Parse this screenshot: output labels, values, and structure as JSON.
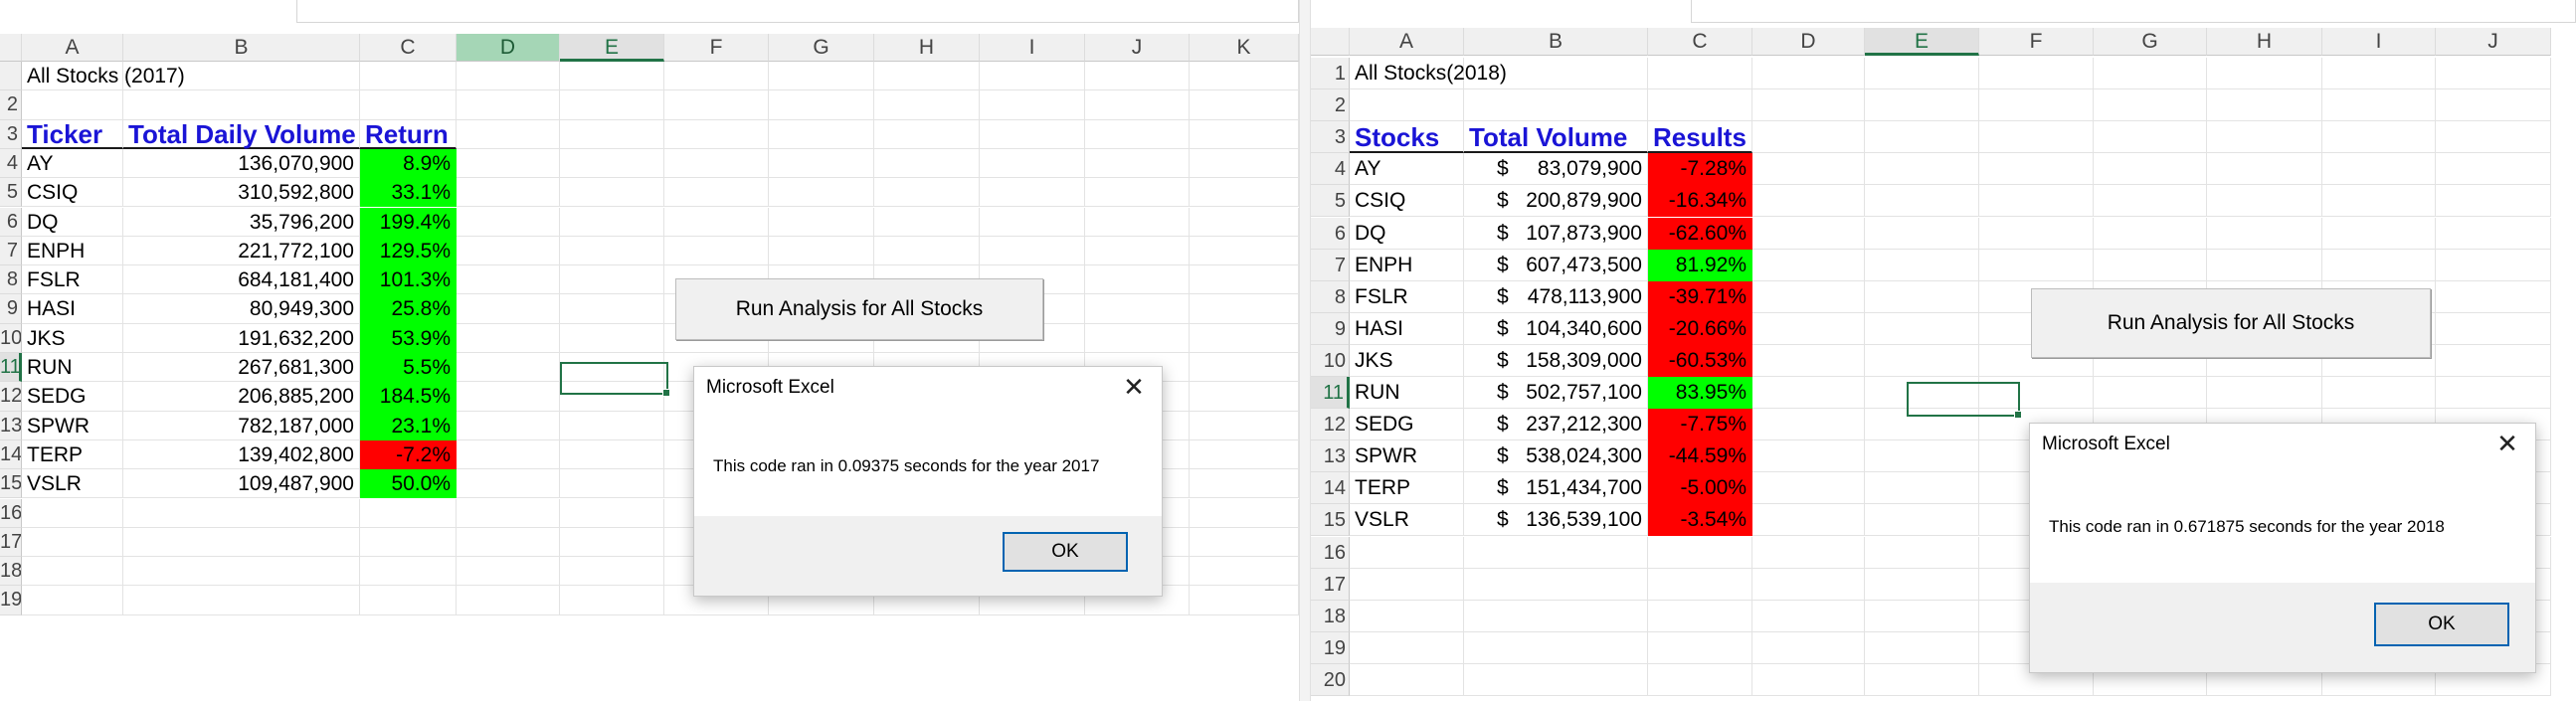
{
  "colors": {
    "accent": "#217346",
    "positive": "#00ff00",
    "negative": "#ff0000",
    "header_text": "#1a14d6"
  },
  "left": {
    "columns": [
      "A",
      "B",
      "C",
      "D",
      "E",
      "F",
      "G",
      "H",
      "I",
      "J",
      "K"
    ],
    "row_labels": [
      "",
      "2",
      "3",
      "4",
      "5",
      "6",
      "7",
      "8",
      "9",
      "10",
      "11",
      "12",
      "13",
      "14",
      "15",
      "16",
      "17",
      "18",
      "19"
    ],
    "title": "All Stocks (2017)",
    "headers": {
      "ticker": "Ticker",
      "volume": "Total Daily Volume",
      "ret": "Return"
    },
    "rows": [
      {
        "ticker": "AY",
        "volume": "136,070,900",
        "ret": "8.9%",
        "positive": true
      },
      {
        "ticker": "CSIQ",
        "volume": "310,592,800",
        "ret": "33.1%",
        "positive": true
      },
      {
        "ticker": "DQ",
        "volume": "35,796,200",
        "ret": "199.4%",
        "positive": true
      },
      {
        "ticker": "ENPH",
        "volume": "221,772,100",
        "ret": "129.5%",
        "positive": true
      },
      {
        "ticker": "FSLR",
        "volume": "684,181,400",
        "ret": "101.3%",
        "positive": true
      },
      {
        "ticker": "HASI",
        "volume": "80,949,300",
        "ret": "25.8%",
        "positive": true
      },
      {
        "ticker": "JKS",
        "volume": "191,632,200",
        "ret": "53.9%",
        "positive": true
      },
      {
        "ticker": "RUN",
        "volume": "267,681,300",
        "ret": "5.5%",
        "positive": true
      },
      {
        "ticker": "SEDG",
        "volume": "206,885,200",
        "ret": "184.5%",
        "positive": true
      },
      {
        "ticker": "SPWR",
        "volume": "782,187,000",
        "ret": "23.1%",
        "positive": true
      },
      {
        "ticker": "TERP",
        "volume": "139,402,800",
        "ret": "-7.2%",
        "positive": false
      },
      {
        "ticker": "VSLR",
        "volume": "109,487,900",
        "ret": "50.0%",
        "positive": true
      }
    ],
    "button_label": "Run Analysis for All Stocks",
    "dialog": {
      "title": "Microsoft Excel",
      "message": "This code ran in 0.09375 seconds for the year 2017",
      "ok": "OK",
      "close": "✕"
    }
  },
  "right": {
    "columns": [
      "A",
      "B",
      "C",
      "D",
      "E",
      "F",
      "G",
      "H",
      "I",
      "J"
    ],
    "row_labels": [
      "1",
      "2",
      "3",
      "4",
      "5",
      "6",
      "7",
      "8",
      "9",
      "10",
      "11",
      "12",
      "13",
      "14",
      "15",
      "16",
      "17",
      "18",
      "19",
      "20"
    ],
    "title": "All Stocks(2018)",
    "headers": {
      "ticker": "Stocks",
      "volume": "Total Volume",
      "ret": "Results"
    },
    "currency": "$",
    "rows": [
      {
        "ticker": "AY",
        "volume": "83,079,900",
        "ret": "-7.28%",
        "positive": false
      },
      {
        "ticker": "CSIQ",
        "volume": "200,879,900",
        "ret": "-16.34%",
        "positive": false
      },
      {
        "ticker": "DQ",
        "volume": "107,873,900",
        "ret": "-62.60%",
        "positive": false
      },
      {
        "ticker": "ENPH",
        "volume": "607,473,500",
        "ret": "81.92%",
        "positive": true
      },
      {
        "ticker": "FSLR",
        "volume": "478,113,900",
        "ret": "-39.71%",
        "positive": false
      },
      {
        "ticker": "HASI",
        "volume": "104,340,600",
        "ret": "-20.66%",
        "positive": false
      },
      {
        "ticker": "JKS",
        "volume": "158,309,000",
        "ret": "-60.53%",
        "positive": false
      },
      {
        "ticker": "RUN",
        "volume": "502,757,100",
        "ret": "83.95%",
        "positive": true
      },
      {
        "ticker": "SEDG",
        "volume": "237,212,300",
        "ret": "-7.75%",
        "positive": false
      },
      {
        "ticker": "SPWR",
        "volume": "538,024,300",
        "ret": "-44.59%",
        "positive": false
      },
      {
        "ticker": "TERP",
        "volume": "151,434,700",
        "ret": "-5.00%",
        "positive": false
      },
      {
        "ticker": "VSLR",
        "volume": "136,539,100",
        "ret": "-3.54%",
        "positive": false
      }
    ],
    "button_label": "Run Analysis for All Stocks",
    "dialog": {
      "title": "Microsoft Excel",
      "message": "This code ran in 0.671875 seconds for the year 2018",
      "ok": "OK",
      "close": "✕"
    }
  }
}
